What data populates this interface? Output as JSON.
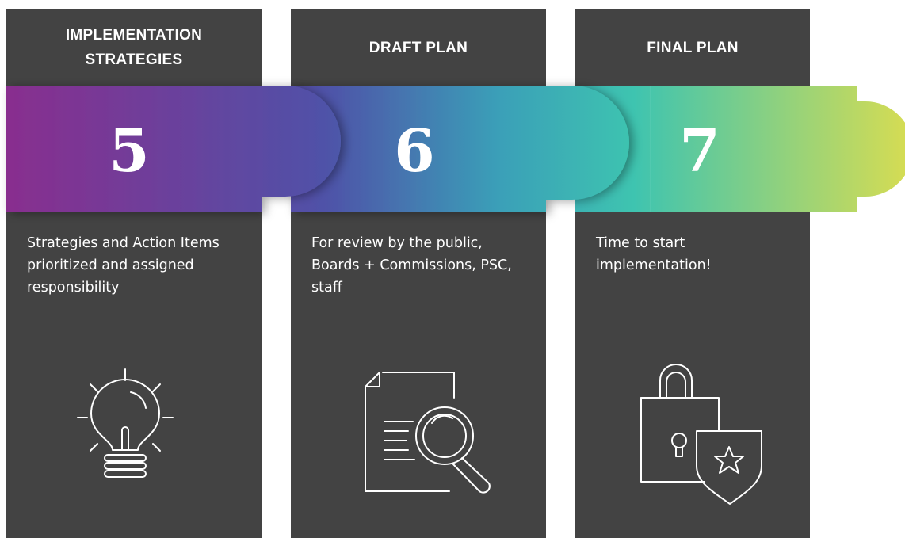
{
  "steps": [
    {
      "title": "IMPLEMENTATION\nSTRATEGIES",
      "number": "5",
      "description": "Strategies and Action Items prioritized and assigned responsibility",
      "icon": "lightbulb-icon"
    },
    {
      "title": "DRAFT PLAN",
      "number": "6",
      "description": "For review by the public, Boards + Commissions, PSC, staff",
      "icon": "document-search-icon"
    },
    {
      "title": "FINAL PLAN",
      "number": "7",
      "description": "Time to start implementation!",
      "icon": "lock-shield-icon"
    }
  ],
  "colors": {
    "panel": "#434343",
    "band_start": "#8a2d8e",
    "band_mid1": "#4f52a8",
    "band_mid2": "#3a9fb8",
    "band_mid3": "#3ec4b0",
    "band_end": "#d4dc54",
    "text": "#ffffff"
  }
}
